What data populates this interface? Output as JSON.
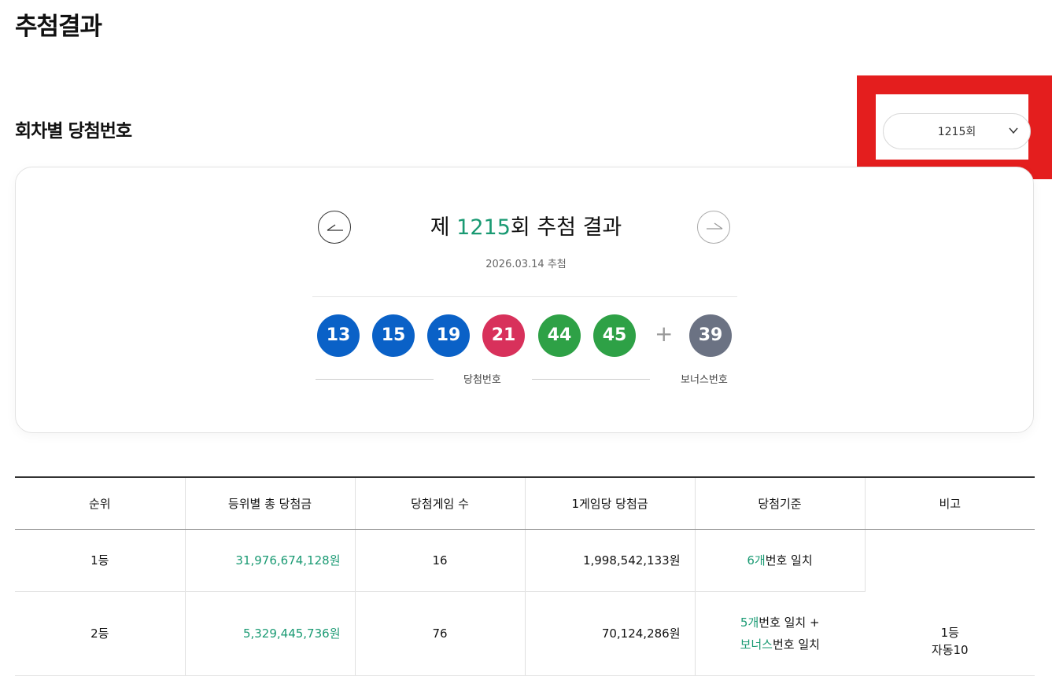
{
  "page_title": "추첨결과",
  "section_title": "회차별 당첨번호",
  "round_select": {
    "value": "1215회"
  },
  "draw": {
    "title_prefix": "제 ",
    "round": "1215",
    "title_suffix": "회 추첨 결과",
    "date": "2026.03.14 추첨",
    "numbers": [
      "13",
      "15",
      "19",
      "21",
      "44",
      "45"
    ],
    "plus": "+",
    "bonus": "39",
    "winning_label": "당첨번호",
    "bonus_label": "보너스번호"
  },
  "colors": {
    "accent": "#1a9a73",
    "highlight": "#e41e1e",
    "ball_blue": "#0a61c7",
    "ball_red": "#d8315b",
    "ball_green": "#2ea146",
    "ball_gray": "#6b7283"
  },
  "table": {
    "headers": [
      "순위",
      "등위별 총 당첨금",
      "당첨게임 수",
      "1게임당 당첨금",
      "당첨기준",
      "비고"
    ],
    "rows": [
      {
        "rank": "1등",
        "total": "31,976,674,128원",
        "games": "16",
        "per_game": "1,998,542,133원",
        "criteria_a": "6개",
        "criteria_b": "번호 일치"
      },
      {
        "rank": "2등",
        "total": "5,329,445,736원",
        "games": "76",
        "per_game": "70,124,286원",
        "criteria_a": "5개",
        "criteria_b": "번호 일치 +",
        "criteria_c": "보너스",
        "criteria_d": "번호 일치"
      }
    ],
    "note_line1": "1등",
    "note_line2": "자동10"
  }
}
